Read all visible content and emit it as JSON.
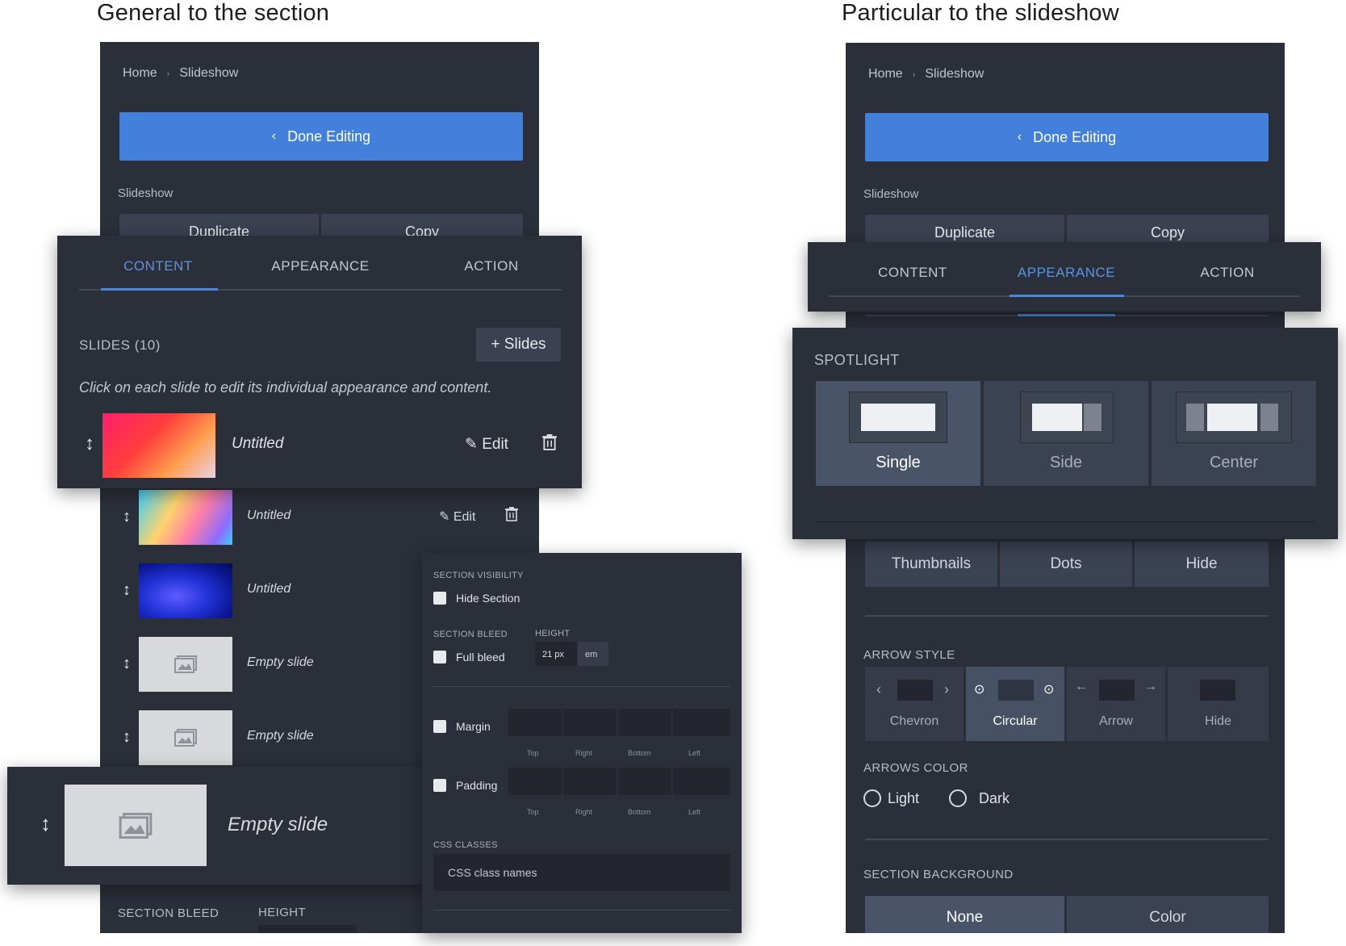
{
  "captions": {
    "left": "General to the section",
    "right": "Particular to the slideshow"
  },
  "breadcrumb": {
    "home": "Home",
    "current": "Slideshow"
  },
  "done_label": "Done Editing",
  "section_label": "Slideshow",
  "duplicate_label": "Duplicate",
  "copy_label": "Copy",
  "tabs": {
    "content": "CONTENT",
    "appearance": "APPEARANCE",
    "action": "ACTION"
  },
  "slides": {
    "heading": "SLIDES (10)",
    "add_label": "+ Slides",
    "hint": "Click on each slide to edit its individual appearance and content.",
    "edit_label": "Edit",
    "items": [
      {
        "title": "Untitled"
      },
      {
        "title": "Untitled"
      },
      {
        "title": "Untitled"
      },
      {
        "title": "Empty slide"
      },
      {
        "title": "Empty slide"
      },
      {
        "title": "Empty slide"
      }
    ]
  },
  "settings": {
    "visibility_heading": "SECTION VISIBILITY",
    "hide_section": "Hide Section",
    "bleed_heading": "SECTION BLEED",
    "height_heading": "HEIGHT",
    "full_bleed": "Full bleed",
    "height_value": "21 px",
    "height_unit": "em",
    "margin": "Margin",
    "padding": "Padding",
    "sides": [
      "Top",
      "Right",
      "Bottom",
      "Left"
    ],
    "css_heading": "CSS CLASSES",
    "css_placeholder": "CSS class names"
  },
  "bottom_left": {
    "bleed": "SECTION BLEED",
    "height": "HEIGHT"
  },
  "spotlight": {
    "heading": "SPOTLIGHT",
    "options": [
      "Single",
      "Side",
      "Center"
    ],
    "selected": "Single"
  },
  "nav_options": [
    "Thumbnails",
    "Dots",
    "Hide"
  ],
  "arrow_style": {
    "heading": "ARROW STYLE",
    "options": [
      "Chevron",
      "Circular",
      "Arrow",
      "Hide"
    ],
    "selected": "Circular"
  },
  "arrows_color": {
    "heading": "ARROWS COLOR",
    "options": [
      "Light",
      "Dark"
    ]
  },
  "section_background": {
    "heading": "SECTION BACKGROUND",
    "options": [
      "None",
      "Color"
    ],
    "selected": "None"
  },
  "icons": [
    "chevron-left-icon",
    "drag-handle-icon",
    "pencil-icon",
    "trash-icon",
    "image-icon",
    "circle-arrow-icon",
    "arrow-icon"
  ],
  "colors": {
    "panel": "#2b2f39",
    "accent": "#4380dc",
    "active_tab": "#5a93e6"
  }
}
